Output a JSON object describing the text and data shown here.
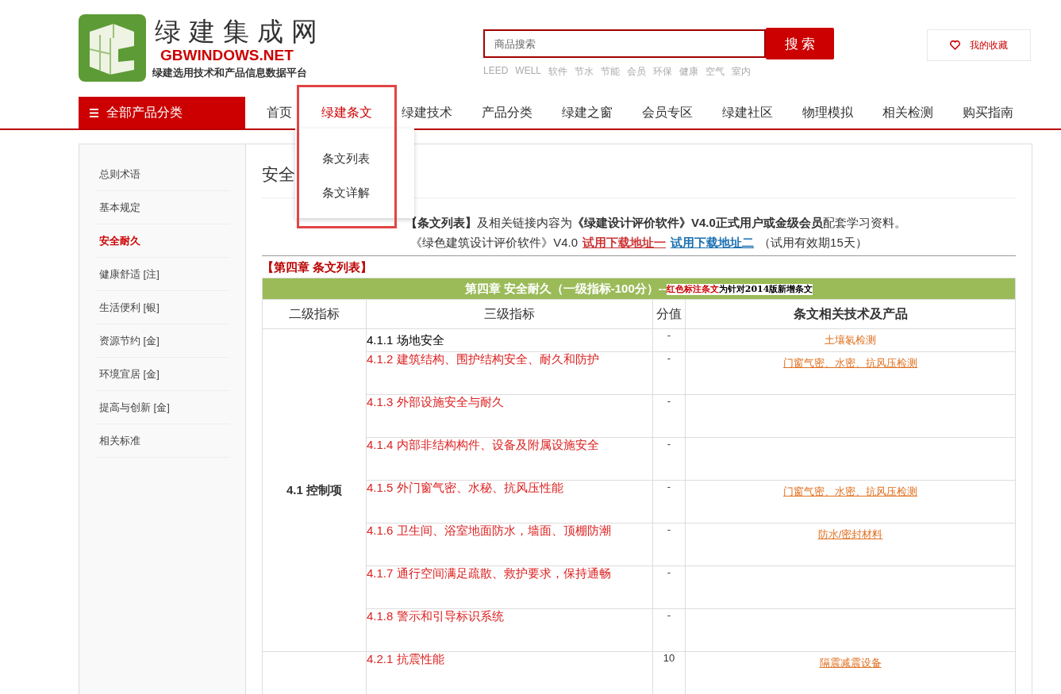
{
  "logo": {
    "title": "绿建集成网",
    "domain": "GBWINDOWS.NET",
    "slogan": "绿建选用技术和产品信息数据平台"
  },
  "search": {
    "placeholder": "商品搜索",
    "button": "搜 索",
    "tags": [
      "LEED",
      "WELL",
      "软件",
      "节水",
      "节能",
      "会员",
      "环保",
      "健康",
      "空气",
      "室内"
    ]
  },
  "favorites": "我的收藏",
  "categories_button": "全部产品分类",
  "nav": [
    {
      "label": "首页",
      "selected": false
    },
    {
      "label": "绿建条文",
      "selected": true
    },
    {
      "label": "绿建技术",
      "selected": false
    },
    {
      "label": "产品分类",
      "selected": false
    },
    {
      "label": "绿建之窗",
      "selected": false
    },
    {
      "label": "会员专区",
      "selected": false
    },
    {
      "label": "绿建社区",
      "selected": false
    },
    {
      "label": "物理模拟",
      "selected": false
    },
    {
      "label": "相关检测",
      "selected": false
    },
    {
      "label": "购买指南",
      "selected": false
    }
  ],
  "dropdown": [
    "条文列表",
    "条文详解"
  ],
  "sidebar": [
    {
      "label": "总则术语",
      "selected": false
    },
    {
      "label": "基本规定",
      "selected": false
    },
    {
      "label": "安全耐久",
      "selected": true
    },
    {
      "label": "健康舒适 [注]",
      "selected": false
    },
    {
      "label": "生活便利 [银]",
      "selected": false
    },
    {
      "label": "资源节约 [金]",
      "selected": false
    },
    {
      "label": "环境宜居 [金]",
      "selected": false
    },
    {
      "label": "提高与创新 [金]",
      "selected": false
    },
    {
      "label": "相关标准",
      "selected": false
    }
  ],
  "heading": "安全",
  "note": "**【条文列表】**及相关链接内容为**《绿建设计评价软件》V4.0正式用户或金级会员**配套学习资料。",
  "download": {
    "text": "《绿色建筑设计评价软件》V4.0",
    "link1": "试用下载地址一",
    "link2": "试用下载地址二",
    "trial": "（试用有效期15天）"
  },
  "section_title": "【第四章 条文列表】",
  "table": {
    "title": "第四章 安全耐久（一级指标-100分）--",
    "title_note": "**红色标注条文**为针对2014版新增条文",
    "columns": [
      "二级指标",
      "三级指标",
      "分值",
      "条文相关技术及产品"
    ],
    "groups": [
      {
        "name": "4.1 控制项",
        "rows": [
          {
            "item": "4.1.1 场地安全",
            "new": false,
            "score": "-",
            "products": "土壤氡检测",
            "link": false
          },
          {
            "item": "4.1.2 建筑结构、围护结构安全、耐久和防护",
            "new": true,
            "score": "-",
            "products": "门窗气密、水密、抗风压检测",
            "link": true
          },
          {
            "item": "4.1.3 外部设施安全与耐久",
            "new": true,
            "score": "-"
          },
          {
            "item": "4.1.4 内部非结构构件、设备及附属设施安全",
            "new": true,
            "score": "-"
          },
          {
            "item": "4.1.5 外门窗气密、水秘、抗风压性能",
            "new": true,
            "score": "-",
            "products": "门窗气密、水密、抗风压检测",
            "link": true
          },
          {
            "item": "4.1.6 卫生间、浴室地面防水，墙面、顶棚防潮",
            "new": true,
            "score": "-",
            "products": "防水/密封材料",
            "link": true
          },
          {
            "item": "4.1.7 通行空间满足疏散、救护要求，保持通畅",
            "new": true,
            "score": "-"
          },
          {
            "item": "4.1.8 警示和引导标识系统",
            "new": true,
            "score": "-"
          }
        ]
      },
      {
        "rows": [
          {
            "item": "4.2.1 抗震性能",
            "new": true,
            "score": "10",
            "products": "隔震减震设备",
            "link": true
          }
        ]
      }
    ]
  }
}
